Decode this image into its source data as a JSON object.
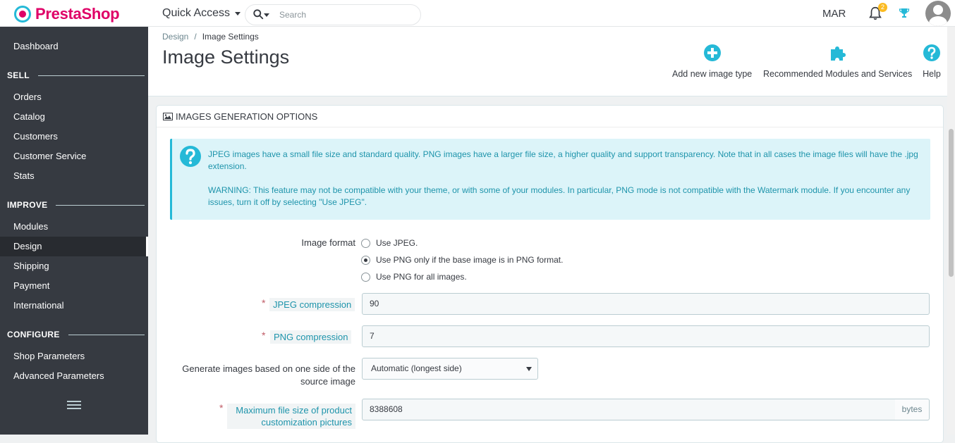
{
  "brand": {
    "name": "PrestaShop"
  },
  "topbar": {
    "quick_access": "Quick Access",
    "search_placeholder": "Search",
    "shop_code": "MAR",
    "notifications_count": "2"
  },
  "sidebar": {
    "dashboard": "Dashboard",
    "sections": [
      {
        "title": "SELL",
        "items": [
          "Orders",
          "Catalog",
          "Customers",
          "Customer Service",
          "Stats"
        ]
      },
      {
        "title": "IMPROVE",
        "items": [
          "Modules",
          "Design",
          "Shipping",
          "Payment",
          "International"
        ]
      },
      {
        "title": "CONFIGURE",
        "items": [
          "Shop Parameters",
          "Advanced Parameters"
        ]
      }
    ],
    "active_item": "Design"
  },
  "header": {
    "breadcrumb": [
      "Design",
      "Image Settings"
    ],
    "title": "Image Settings",
    "toolbar": [
      {
        "label": "Add new image type",
        "icon": "plus-circle-icon"
      },
      {
        "label": "Recommended Modules and Services",
        "icon": "puzzle-icon"
      },
      {
        "label": "Help",
        "icon": "help-icon"
      }
    ]
  },
  "panel": {
    "title": "IMAGES GENERATION OPTIONS",
    "alert": {
      "p1": "JPEG images have a small file size and standard quality. PNG images have a larger file size, a higher quality and support transparency. Note that in all cases the image files will have the .jpg extension.",
      "p2": "WARNING: This feature may not be compatible with your theme, or with some of your modules. In particular, PNG mode is not compatible with the Watermark module. If you encounter any issues, turn it off by selecting \"Use JPEG\"."
    },
    "image_format": {
      "label": "Image format",
      "options": [
        "Use JPEG.",
        "Use PNG only if the base image is in PNG format.",
        "Use PNG for all images."
      ],
      "selected_index": 1
    },
    "jpeg_compression": {
      "label": "JPEG compression",
      "value": "90"
    },
    "png_compression": {
      "label": "PNG compression",
      "value": "7"
    },
    "generate_side": {
      "label_line1": "Generate images based on one side of the",
      "label_line2": "source image",
      "value": "Automatic (longest side)"
    },
    "max_file_size": {
      "label_line1": "Maximum file size of product",
      "label_line2": "customization pictures",
      "value": "8388608",
      "unit": "bytes"
    }
  },
  "colors": {
    "accent": "#25b9d7",
    "brand_pink": "#df0067",
    "sidebar_bg": "#363a41",
    "alert_bg": "#dcf4f9",
    "alert_text": "#1e94ab",
    "required": "#c05c67"
  }
}
